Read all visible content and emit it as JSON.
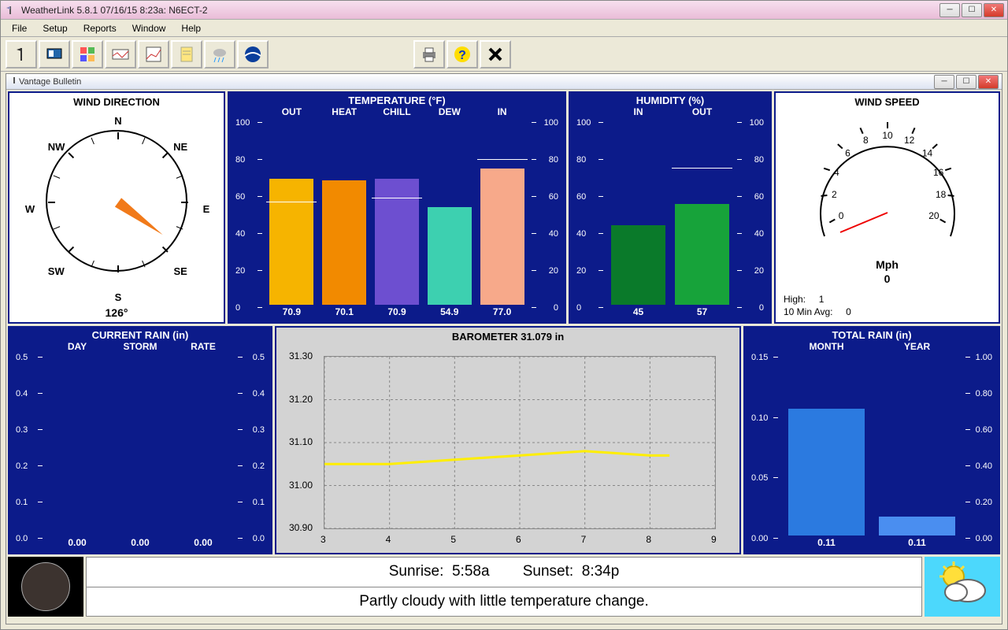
{
  "window": {
    "title": "WeatherLink 5.8.1   07/16/15    8:23a: N6ECT-2"
  },
  "menubar": [
    "File",
    "Setup",
    "Reports",
    "Window",
    "Help"
  ],
  "toolbar_icons": [
    "anemometer",
    "console",
    "instruments",
    "stripchart",
    "graph",
    "notepad",
    "rain-cloud",
    "noaa-logo",
    "printer",
    "help",
    "close-x"
  ],
  "inner_window": {
    "title": "Vantage Bulletin"
  },
  "wind_dir": {
    "title": "WIND DIRECTION",
    "labels": [
      "N",
      "NE",
      "E",
      "SE",
      "S",
      "SW",
      "W",
      "NW"
    ],
    "reading": "126°",
    "angle_deg": 126
  },
  "temperature": {
    "title": "TEMPERATURE  (°F)",
    "range": [
      0,
      100
    ],
    "ticks": [
      0,
      20,
      40,
      60,
      80,
      100
    ],
    "series": [
      {
        "label": "OUT",
        "value": 70.9,
        "color": "#f6b400",
        "marker": 58
      },
      {
        "label": "HEAT",
        "value": 70.1,
        "color": "#f28a00"
      },
      {
        "label": "CHILL",
        "value": 70.9,
        "color": "#6d4fd0",
        "marker": 60
      },
      {
        "label": "DEW",
        "value": 54.9,
        "color": "#3dd0b0"
      },
      {
        "label": "IN",
        "value": 77.0,
        "color": "#f7a98a",
        "marker": 82
      }
    ],
    "value_labels": [
      "70.9",
      "70.1",
      "70.9",
      "54.9",
      "77.0"
    ]
  },
  "humidity": {
    "title": "HUMIDITY  (%)",
    "range": [
      0,
      100
    ],
    "ticks": [
      0,
      20,
      40,
      60,
      80,
      100
    ],
    "series": [
      {
        "label": "IN",
        "value": 45,
        "color": "#0a7a2a"
      },
      {
        "label": "OUT",
        "value": 57,
        "color": "#17a33a",
        "marker": 77
      }
    ],
    "value_labels": [
      "45",
      "57"
    ]
  },
  "wind_speed": {
    "title": "WIND SPEED",
    "dial_labels": [
      "0",
      "2",
      "4",
      "6",
      "8",
      "10",
      "12",
      "14",
      "16",
      "18",
      "20"
    ],
    "unit": "Mph",
    "current": "0",
    "high_label": "High:",
    "high": "1",
    "avg_label": "10 Min Avg:",
    "avg": "0"
  },
  "current_rain": {
    "title": "CURRENT RAIN  (in)",
    "range": [
      0,
      0.5
    ],
    "ticks": [
      "0.0",
      "0.1",
      "0.2",
      "0.3",
      "0.4",
      "0.5"
    ],
    "series": [
      {
        "label": "DAY",
        "value": 0.0
      },
      {
        "label": "STORM",
        "value": 0.0
      },
      {
        "label": "RATE",
        "value": 0.0
      }
    ],
    "value_labels": [
      "0.00",
      "0.00",
      "0.00"
    ]
  },
  "barometer": {
    "title": "BAROMETER 31.079 in",
    "y_ticks": [
      "30.90",
      "31.00",
      "31.10",
      "31.20",
      "31.30"
    ],
    "y_range": [
      30.9,
      31.3
    ],
    "x_ticks": [
      "3",
      "4",
      "5",
      "6",
      "7",
      "8",
      "9"
    ],
    "x_range": [
      3,
      9
    ],
    "line": [
      [
        3,
        31.05
      ],
      [
        4,
        31.05
      ],
      [
        5,
        31.06
      ],
      [
        6,
        31.07
      ],
      [
        7,
        31.08
      ],
      [
        8,
        31.07
      ],
      [
        8.3,
        31.07
      ]
    ]
  },
  "total_rain": {
    "title": "TOTAL RAIN  (in)",
    "left_range": [
      0,
      0.15
    ],
    "left_ticks": [
      "0.00",
      "0.05",
      "0.10",
      "0.15"
    ],
    "right_range": [
      0,
      1.0
    ],
    "right_ticks": [
      "0.00",
      "0.20",
      "0.40",
      "0.60",
      "0.80",
      "1.00"
    ],
    "series": [
      {
        "label": "MONTH",
        "value": 0.11,
        "axis": "left",
        "color": "#2b7ae0"
      },
      {
        "label": "YEAR",
        "value": 0.11,
        "axis": "right",
        "color": "#4a8ef0"
      }
    ],
    "value_labels": [
      "0.11",
      "0.11"
    ]
  },
  "sun": {
    "sunrise_label": "Sunrise:",
    "sunrise": "5:58a",
    "sunset_label": "Sunset:",
    "sunset": "8:34p"
  },
  "forecast": "Partly cloudy with little temperature change.",
  "chart_data": [
    {
      "type": "bar",
      "title": "TEMPERATURE (°F)",
      "categories": [
        "OUT",
        "HEAT",
        "CHILL",
        "DEW",
        "IN"
      ],
      "values": [
        70.9,
        70.1,
        70.9,
        54.9,
        77.0
      ],
      "ylim": [
        0,
        100
      ],
      "ylabel": "°F"
    },
    {
      "type": "bar",
      "title": "HUMIDITY (%)",
      "categories": [
        "IN",
        "OUT"
      ],
      "values": [
        45,
        57
      ],
      "ylim": [
        0,
        100
      ],
      "ylabel": "%"
    },
    {
      "type": "bar",
      "title": "CURRENT RAIN (in)",
      "categories": [
        "DAY",
        "STORM",
        "RATE"
      ],
      "values": [
        0.0,
        0.0,
        0.0
      ],
      "ylim": [
        0,
        0.5
      ],
      "ylabel": "in"
    },
    {
      "type": "line",
      "title": "BAROMETER 31.079 in",
      "x": [
        3,
        4,
        5,
        6,
        7,
        8,
        8.3
      ],
      "values": [
        31.05,
        31.05,
        31.06,
        31.07,
        31.08,
        31.07,
        31.07
      ],
      "ylim": [
        30.9,
        31.3
      ],
      "xlim": [
        3,
        9
      ],
      "ylabel": "in"
    },
    {
      "type": "bar",
      "title": "TOTAL RAIN (in)",
      "series": [
        {
          "name": "MONTH",
          "values": [
            0.11
          ],
          "ylim": [
            0,
            0.15
          ]
        },
        {
          "name": "YEAR",
          "values": [
            0.11
          ],
          "ylim": [
            0,
            1.0
          ]
        }
      ]
    }
  ]
}
